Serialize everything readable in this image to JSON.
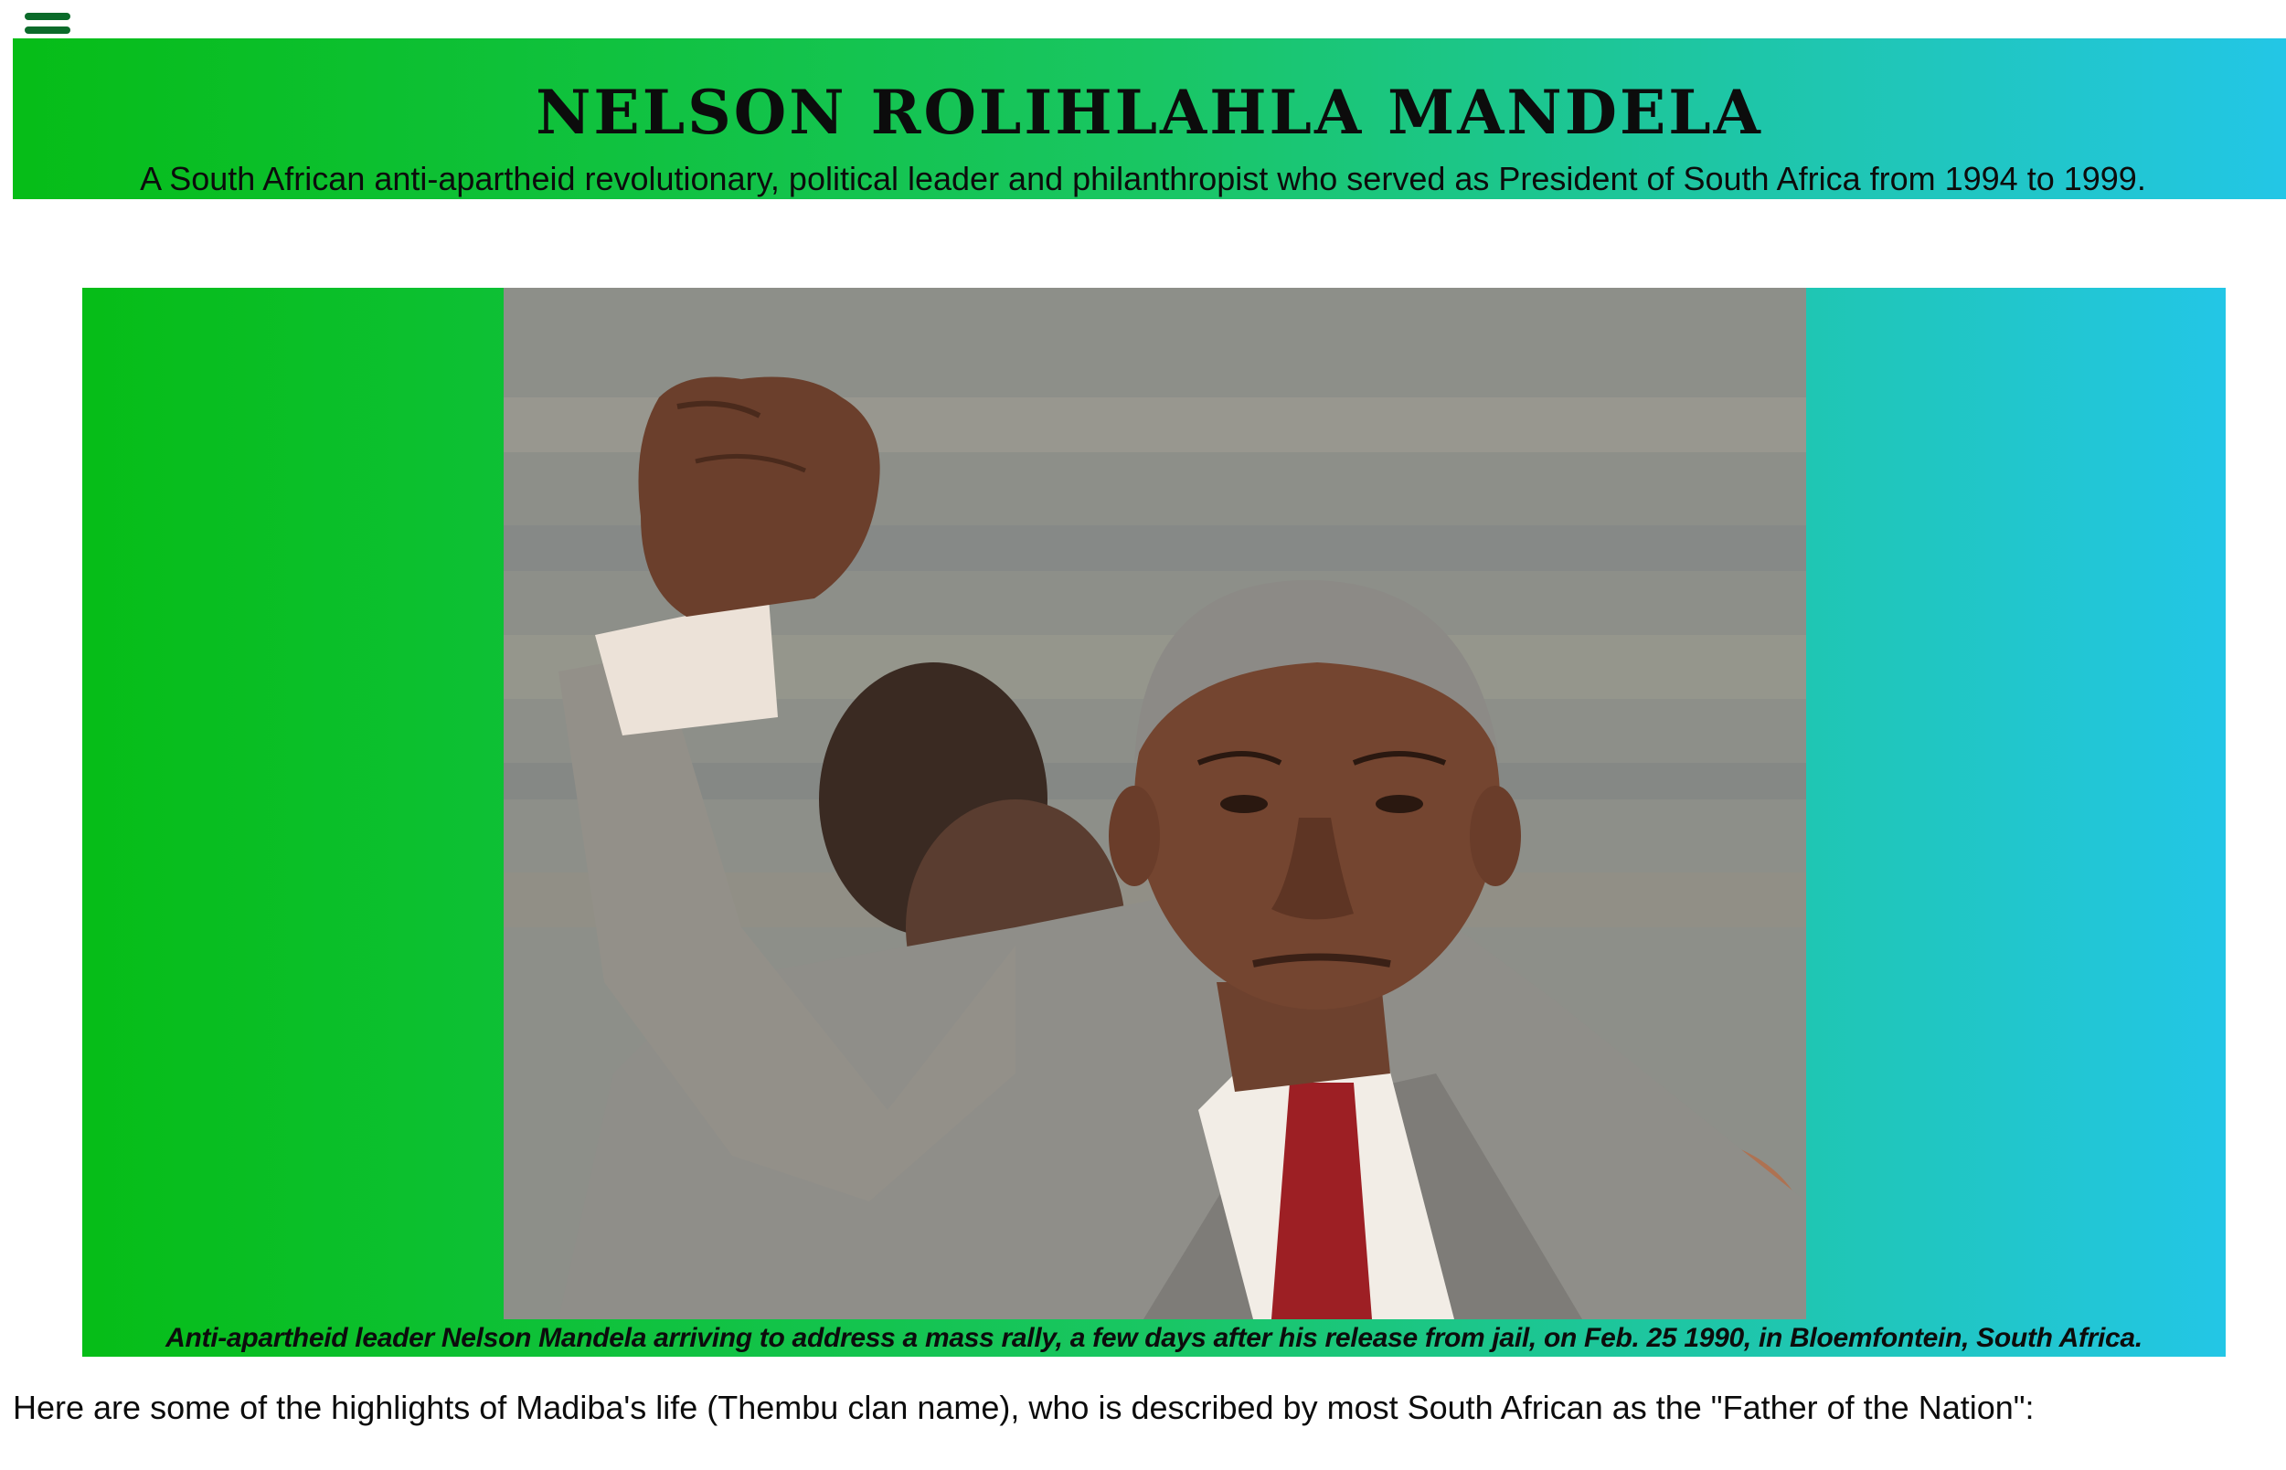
{
  "nav": {
    "menu_icon": "hamburger-menu-icon"
  },
  "header": {
    "title": "NELSON ROLIHLAHLA MANDELA",
    "subtitle": "A South African anti-apartheid revolutionary, political leader and philanthropist who served as President of South Africa from 1994 to 1999."
  },
  "figure": {
    "image_alt": "Nelson Mandela raising his fist",
    "caption": "Anti-apartheid leader Nelson Mandela arriving to address a mass rally, a few days after his release from jail, on Feb. 25 1990, in Bloemfontein, South Africa."
  },
  "intro": {
    "text": "Here are some of the highlights of Madiba's life (Thembu clan name), who is described by most South African as the \"Father of the Nation\":"
  },
  "colors": {
    "gradient_start": "#06bd17",
    "gradient_mid": "#19c663",
    "gradient_end": "#23c6e6",
    "menu_icon": "#0b6b2a",
    "text": "#0c0c0c"
  }
}
